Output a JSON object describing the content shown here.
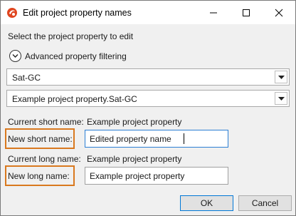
{
  "window": {
    "title": "Edit project property names"
  },
  "titlebar": {
    "app_icon": "app-logo-icon",
    "min_icon": "minimize-icon",
    "max_icon": "maximize-icon",
    "close_icon": "close-icon"
  },
  "form": {
    "instruction": "Select the project property to edit",
    "advanced_filtering_label": "Advanced property filtering",
    "combo1_value": "Sat-GC",
    "combo2_value": "Example project property.Sat-GC",
    "current_short_label": "Current short name:",
    "current_short_value": "Example project property",
    "new_short_label": "New short name:",
    "new_short_value": "Edited property name",
    "current_long_label": "Current long name:",
    "current_long_value": "Example project property",
    "new_long_label": "New long name:",
    "new_long_value": "Example project property"
  },
  "buttons": {
    "ok": "OK",
    "cancel": "Cancel"
  },
  "colors": {
    "highlight": "#d9791f",
    "focus": "#2c7fd4",
    "app_icon": "#e0451f"
  }
}
